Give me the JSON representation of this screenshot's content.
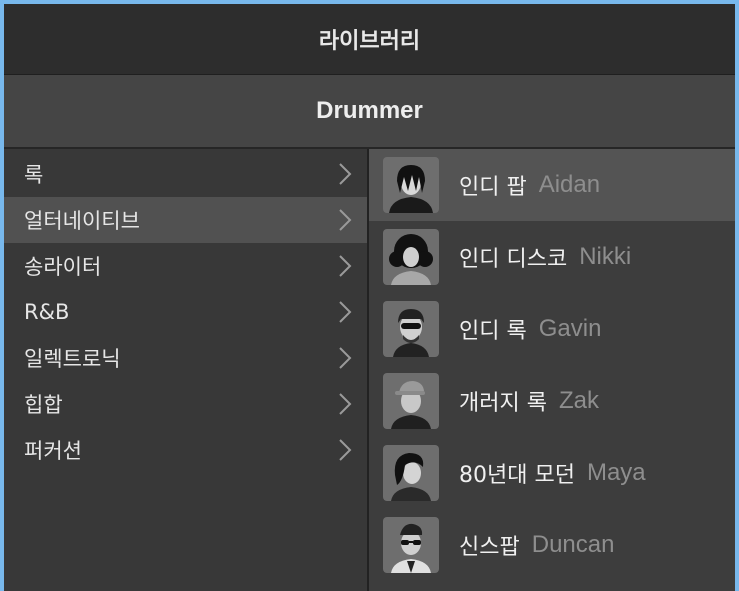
{
  "window": {
    "title": "라이브러리",
    "subtitle": "Drummer"
  },
  "categories": [
    {
      "label": "록",
      "selected": false
    },
    {
      "label": "얼터네이티브",
      "selected": true
    },
    {
      "label": "송라이터",
      "selected": false
    },
    {
      "label": "R&B",
      "selected": false
    },
    {
      "label": "일렉트로닉",
      "selected": false
    },
    {
      "label": "힙합",
      "selected": false
    },
    {
      "label": "퍼커션",
      "selected": false
    }
  ],
  "drummers": [
    {
      "genre": "인디 팝",
      "name": "Aidan",
      "selected": true
    },
    {
      "genre": "인디 디스코",
      "name": "Nikki",
      "selected": false
    },
    {
      "genre": "인디 록",
      "name": "Gavin",
      "selected": false
    },
    {
      "genre": "개러지 록",
      "name": "Zak",
      "selected": false
    },
    {
      "genre": "80년대 모던",
      "name": "Maya",
      "selected": false
    },
    {
      "genre": "신스팝",
      "name": "Duncan",
      "selected": false
    }
  ],
  "colors": {
    "page_background": "#78b8ec",
    "title_bar": "#2d2d2d",
    "selected_row": "#515151",
    "drummer_name": "#8e8e8e"
  }
}
